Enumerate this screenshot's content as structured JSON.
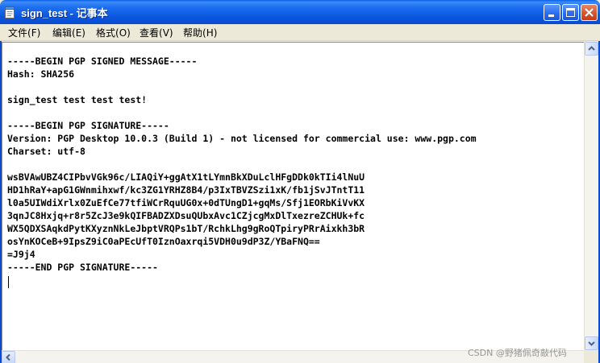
{
  "window": {
    "title": "sign_test - 记事本",
    "titlebar_color": "#0b56df"
  },
  "title_buttons": {
    "minimize_icon": "minimize-icon",
    "maximize_icon": "maximize-icon",
    "close_icon": "close-icon"
  },
  "menu": {
    "items": [
      {
        "label": "文件",
        "accel": "(F)"
      },
      {
        "label": "编辑",
        "accel": "(E)"
      },
      {
        "label": "格式",
        "accel": "(O)"
      },
      {
        "label": "查看",
        "accel": "(V)"
      },
      {
        "label": "帮助",
        "accel": "(H)"
      }
    ]
  },
  "editor": {
    "content": "-----BEGIN PGP SIGNED MESSAGE-----\nHash: SHA256\n\nsign_test test test test!\n\n-----BEGIN PGP SIGNATURE-----\nVersion: PGP Desktop 10.0.3 (Build 1) - not licensed for commercial use: www.pgp.com\nCharset: utf-8\n\nwsBVAwUBZ4CIPbvVGk96c/LIAQiY+ggAtX1tLYmnBkXDuLclHFgDDk0kTIi4lNuU\nHD1hRaY+apG1GWnmihxwf/kc3ZG1YRHZ8B4/p3IxTBVZSzi1xK/fb1jSvJTntT11\nl0a5UIWdiXrlx0ZuEfCe77tfiWCrRquUG0x+0dTUngD1+gqMs/Sfj1EORbKiVvKX\n3qnJC8Hxjq+r8r5ZcJ3e9kQIFBADZXDsuQUbxAvc1CZjcgMxDlTxezreZCHUk+fc\nWX5QDXSAqkdPytKXyznNkLeJbptVRQPs1bT/RchkLhg9gRoQTpiryPRrAixkh3bR\nosYnKOCeB+9IpsZ9iC0aPEcUfT0IznOaxrqi5VDH0u9dP3Z/YBaFNQ==\n=J9j4\n-----END PGP SIGNATURE-----"
  },
  "watermark": {
    "text": "CSDN @野猪佩奇敲代码"
  }
}
